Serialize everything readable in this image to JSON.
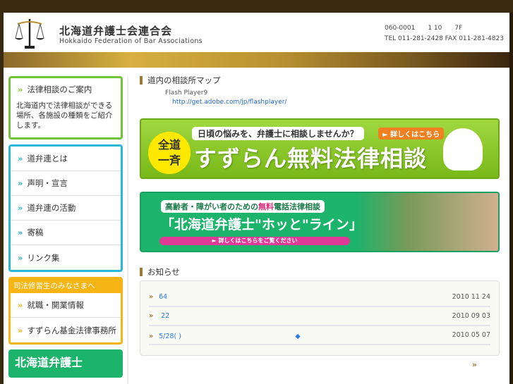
{
  "header": {
    "org_ja": "北海道弁護士会連合会",
    "org_en": "Hokkaido Federation of Bar Associations",
    "address": "060-0001　　1 10　　7F",
    "tel": "TEL 011-281-2428 FAX 011-281-4823"
  },
  "sidebar": {
    "consult": {
      "title": "法律相談のご案内",
      "text": "北海道内で法律相談ができる場所、各施設の種類をご紹介します。"
    },
    "menu": [
      {
        "label": "道弁連とは"
      },
      {
        "label": "声明・宣言"
      },
      {
        "label": "道弁連の活動"
      },
      {
        "label": "寄稿"
      },
      {
        "label": "リンク集"
      }
    ],
    "trainee": {
      "title": "司法修習生のみなさまへ",
      "items": [
        {
          "label": "就職・開業情報"
        },
        {
          "label": "すずらん基金法律事務所"
        }
      ]
    },
    "bottom_banner": "北海道弁護士"
  },
  "main": {
    "map_title": "道内の相談所マップ",
    "flash_text": "Flash Player9",
    "flash_link": "http://get.adobe.com/jp/flashplayer/",
    "banner1": {
      "circle_line1": "全道",
      "circle_line2": "一斉",
      "question": "日頃の悩みを、弁護士に相談しませんか？",
      "button": "► 詳しくはこちら",
      "title": "すずらん無料法律相談"
    },
    "banner2": {
      "question_pre": "高齢者・障がい者のための",
      "question_em": "無料",
      "question_post": "電話法律相談",
      "title": "「北海道弁護士\"ホッと\"ライン」",
      "button": "► 詳しくはこちらをご覧ください"
    },
    "news_title": "お知らせ",
    "news": [
      {
        "title": "64",
        "date": "2010 11 24"
      },
      {
        "title": " 22",
        "date": "2010 09 03"
      },
      {
        "title": "5/28( )　　　　　　　　　　　　　　　　　◆",
        "date": "2010 05 07"
      }
    ],
    "more": "»"
  }
}
